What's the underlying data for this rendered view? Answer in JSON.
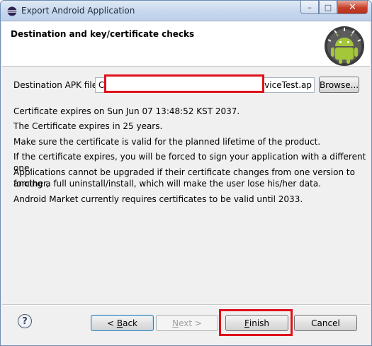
{
  "window": {
    "title": "Export Android Application",
    "controls": {
      "minimize": "–",
      "maximize": "□",
      "close": "✕"
    }
  },
  "header": {
    "title": "Destination and key/certificate checks",
    "logo": "android-logo"
  },
  "destination": {
    "label": "Destination APK file:",
    "value_start": "C",
    "value_end": "DeviceTest.ap",
    "browse_label": "Browse..."
  },
  "messages": [
    "Certificate expires on Sun Jun 07 13:48:52 KST 2037.",
    "The Certificate expires in 25 years.",
    "Make sure the certificate is valid for the planned lifetime of the product.",
    "If the certificate expires, you will be forced to sign your application with a different one.",
    "Applications cannot be upgraded if their certificate changes from one version to another,",
    "forcing a full uninstall/install, which will make the user lose his/her data.",
    "Android Market currently requires certificates to be valid until 2033."
  ],
  "footer": {
    "help_icon": "?",
    "back": {
      "mnemonic": "< ",
      "underlined": "B",
      "rest": "ack"
    },
    "next": {
      "underlined": "N",
      "rest": "ext >"
    },
    "finish": {
      "underlined": "F",
      "rest": "inish"
    },
    "cancel_label": "Cancel"
  },
  "colors": {
    "highlight": "#e0101a",
    "title_bar": "#c7d8ee",
    "android_green": "#a4c639"
  }
}
